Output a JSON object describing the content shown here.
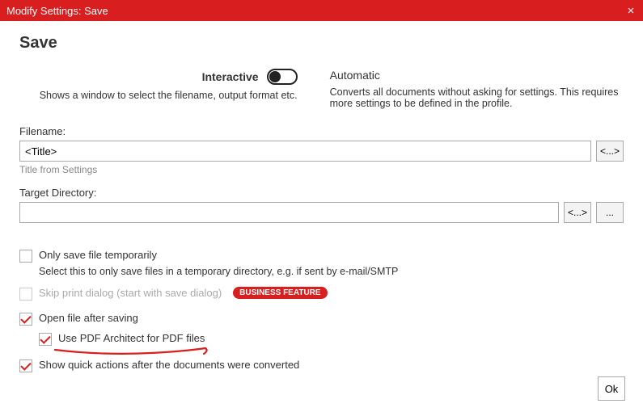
{
  "titlebar": {
    "title": "Modify Settings: Save"
  },
  "page": {
    "heading": "Save"
  },
  "modes": {
    "interactive_label": "Interactive",
    "interactive_desc": "Shows a window to select the filename, output format etc.",
    "automatic_label": "Automatic",
    "automatic_desc": "Converts all documents without asking for settings. This requires more settings to be defined in the profile."
  },
  "filename": {
    "label": "Filename:",
    "value": "<Title>",
    "token_btn": "<...>",
    "hint": "Title from Settings"
  },
  "targetdir": {
    "label": "Target Directory:",
    "value": "",
    "token_btn": "<...>",
    "browse_btn": "..."
  },
  "options": {
    "only_temp_label": "Only save file temporarily",
    "only_temp_desc": "Select this to only save files in a temporary directory, e.g. if sent by e-mail/SMTP",
    "skip_print_label": "Skip print dialog (start with save dialog)",
    "business_badge": "BUSINESS FEATURE",
    "open_after_label": "Open file after saving",
    "use_architect_label": "Use PDF Architect for PDF files",
    "show_quick_label": "Show quick actions after the documents were converted"
  },
  "footer": {
    "ok": "Ok"
  }
}
